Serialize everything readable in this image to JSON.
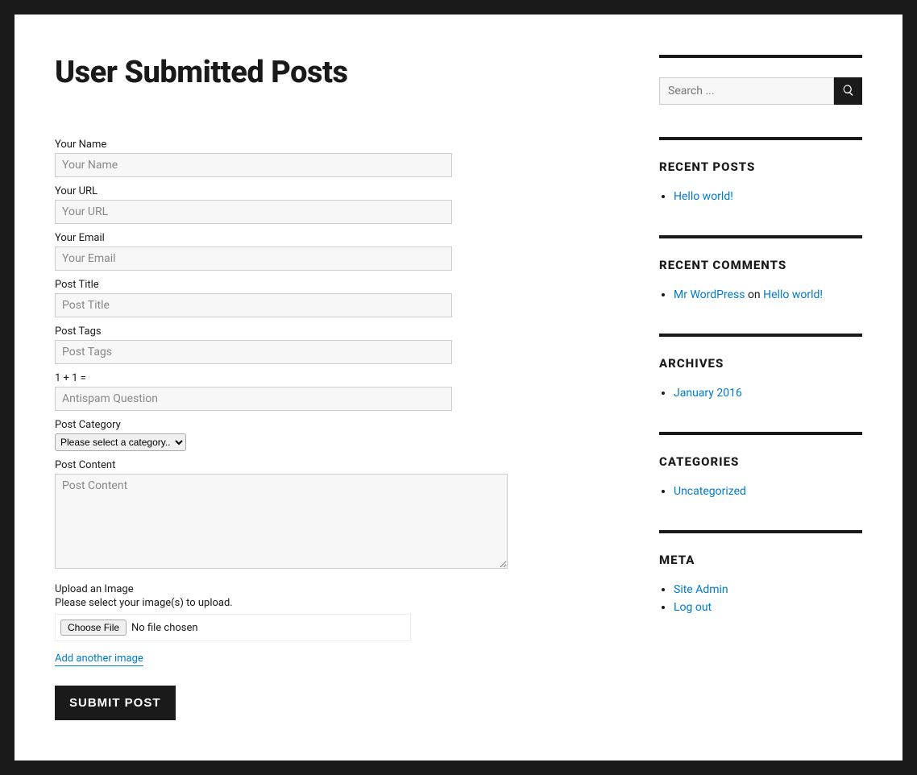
{
  "page": {
    "title": "User Submitted Posts"
  },
  "form": {
    "name": {
      "label": "Your Name",
      "placeholder": "Your Name"
    },
    "url": {
      "label": "Your URL",
      "placeholder": "Your URL"
    },
    "email": {
      "label": "Your Email",
      "placeholder": "Your Email"
    },
    "title": {
      "label": "Post Title",
      "placeholder": "Post Title"
    },
    "tags": {
      "label": "Post Tags",
      "placeholder": "Post Tags"
    },
    "antispam": {
      "label": "1 + 1 =",
      "placeholder": "Antispam Question"
    },
    "category": {
      "label": "Post Category",
      "selected": "Please select a category.."
    },
    "content": {
      "label": "Post Content",
      "placeholder": "Post Content"
    },
    "upload": {
      "label": "Upload an Image",
      "desc": "Please select your image(s) to upload.",
      "button": "Choose File",
      "status": "No file chosen",
      "add_link": "Add another image"
    },
    "submit": "SUBMIT POST"
  },
  "sidebar": {
    "search": {
      "placeholder": "Search ..."
    },
    "recent_posts": {
      "title": "RECENT POSTS",
      "items": [
        "Hello world!"
      ]
    },
    "recent_comments": {
      "title": "RECENT COMMENTS",
      "items": [
        {
          "author": "Mr WordPress",
          "on": " on ",
          "post": "Hello world!"
        }
      ]
    },
    "archives": {
      "title": "ARCHIVES",
      "items": [
        "January 2016"
      ]
    },
    "categories": {
      "title": "CATEGORIES",
      "items": [
        "Uncategorized"
      ]
    },
    "meta": {
      "title": "META",
      "items": [
        "Site Admin",
        "Log out"
      ]
    }
  }
}
